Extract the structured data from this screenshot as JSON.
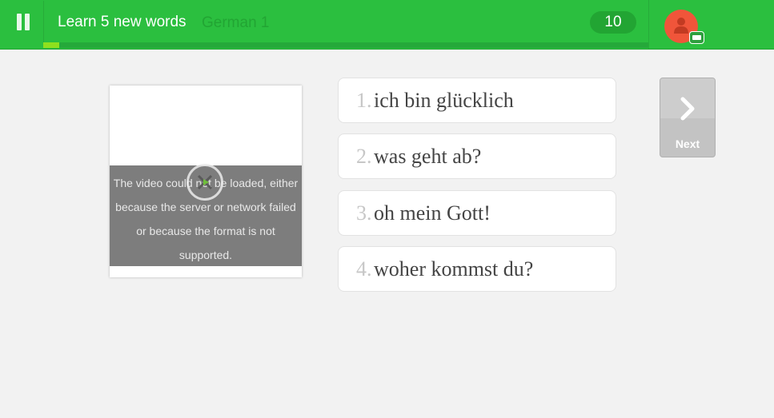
{
  "header": {
    "title": "Learn 5 new words",
    "course": "German 1",
    "score": "10",
    "progress_fraction": 0.027
  },
  "video": {
    "error_text": "The video could not be loaded, either because the server or network failed or because the format is not supported."
  },
  "choices": [
    {
      "number": "1.",
      "text": "ich bin glücklich"
    },
    {
      "number": "2.",
      "text": "was geht ab?"
    },
    {
      "number": "3.",
      "text": "oh mein Gott!"
    },
    {
      "number": "4.",
      "text": "woher kommst du?"
    }
  ],
  "next_button": {
    "label": "Next"
  },
  "icons": {
    "pause": "pause-icon",
    "avatar": "user-icon",
    "badge": "id-card-icon",
    "video_error": "close-icon",
    "next": "chevron-right-icon"
  },
  "colors": {
    "header_green": "#2bbf3f",
    "progress_fill": "#8fe01e",
    "avatar_red": "#f0553a",
    "next_gray": "#c3c3c3"
  }
}
